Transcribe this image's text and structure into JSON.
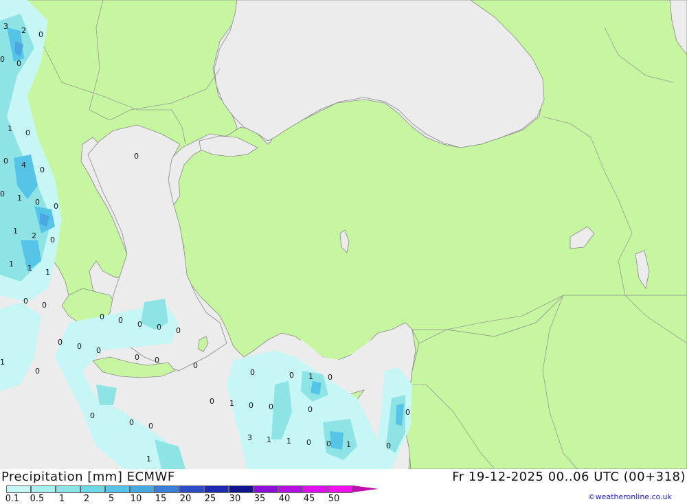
{
  "map": {
    "colors": {
      "land": "#c6f7a0",
      "sea": "#ececec",
      "border": "#999999",
      "coast": "#888888"
    },
    "precip_labels": [
      "3",
      "2",
      "0",
      "0",
      "0",
      "1",
      "0",
      "0",
      "4",
      "0",
      "0",
      "1",
      "0",
      "0",
      "1",
      "2",
      "0",
      "1",
      "1",
      "1",
      "0",
      "0",
      "0",
      "0",
      "0",
      "0",
      "0",
      "0",
      "0",
      "0",
      "0",
      "0",
      "1",
      "0",
      "0",
      "0",
      "0",
      "0",
      "1",
      "0",
      "0",
      "1",
      "0",
      "0",
      "0",
      "0",
      "0",
      "0",
      "0",
      "3",
      "1",
      "1",
      "0",
      "0",
      "1",
      "0",
      "1"
    ]
  },
  "footer": {
    "title": "Precipitation [mm] ECMWF",
    "timestamp": "Fr 19-12-2025 00..06 UTC (00+318)",
    "credit": "©weatheronline.co.uk"
  },
  "legend": {
    "labels": [
      "0.1",
      "0.5",
      "1",
      "2",
      "5",
      "10",
      "15",
      "20",
      "25",
      "30",
      "35",
      "40",
      "45",
      "50"
    ],
    "colors": [
      "#c6f6f6",
      "#a8eeee",
      "#8ee4e4",
      "#6fd6e4",
      "#55c4e6",
      "#4aa8e0",
      "#3c7ed8",
      "#2c4cc8",
      "#1c2ab4",
      "#101490",
      "#8c10d8",
      "#b410e0",
      "#e010f0",
      "#f010f0",
      "#c010b0"
    ]
  }
}
